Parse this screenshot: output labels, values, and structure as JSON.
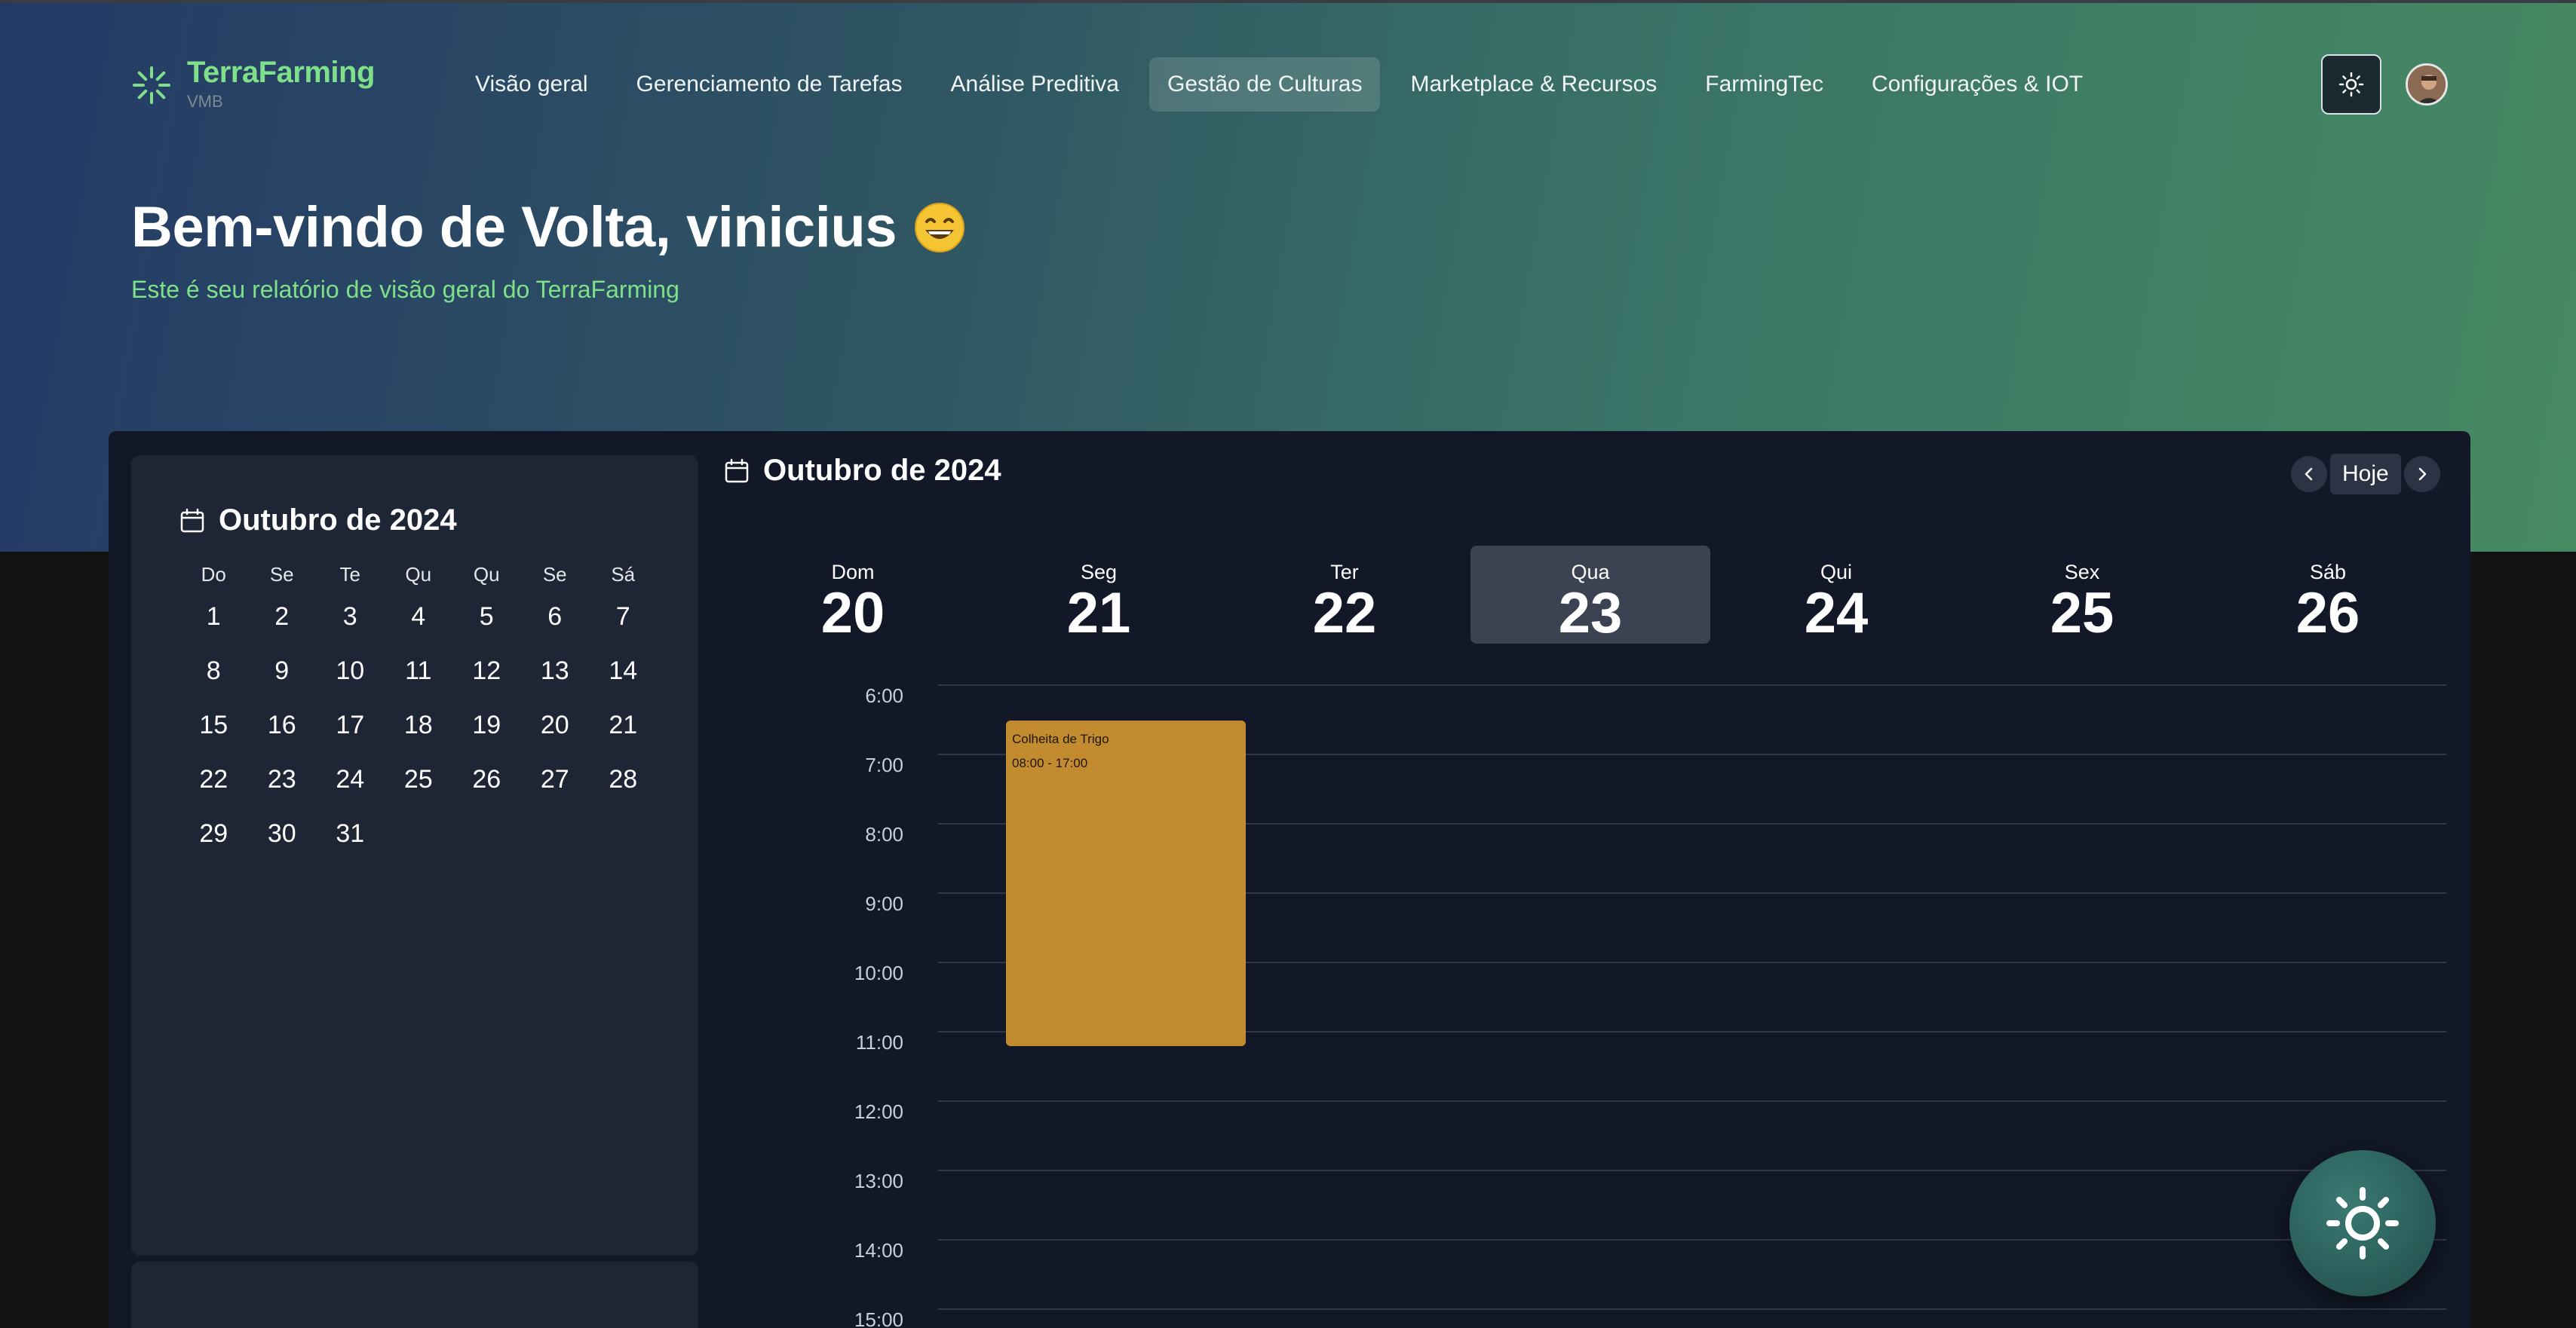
{
  "app": {
    "name": "TerraFarming",
    "subtitle": "VMB"
  },
  "nav": {
    "items": [
      {
        "label": "Visão geral",
        "active": false
      },
      {
        "label": "Gerenciamento de Tarefas",
        "active": false
      },
      {
        "label": "Análise Preditiva",
        "active": false
      },
      {
        "label": "Gestão de Culturas",
        "active": true
      },
      {
        "label": "Marketplace & Recursos",
        "active": false
      },
      {
        "label": "FarmingTec",
        "active": false
      },
      {
        "label": "Configurações & IOT",
        "active": false
      }
    ]
  },
  "header": {
    "theme_toggle_icon": "sun-icon",
    "avatar_icon": "user-avatar"
  },
  "greeting": {
    "title": "Bem-vindo de Volta, vinicius",
    "emoji_icon": "grinning-face-icon",
    "subtitle": "Este é seu relatório de visão geral do TerraFarming"
  },
  "mini_calendar": {
    "month_label": "Outubro de 2024",
    "weekdays": [
      "Do",
      "Se",
      "Te",
      "Qu",
      "Qu",
      "Se",
      "Sá"
    ],
    "days": [
      "1",
      "2",
      "3",
      "4",
      "5",
      "6",
      "7",
      "8",
      "9",
      "10",
      "11",
      "12",
      "13",
      "14",
      "15",
      "16",
      "17",
      "18",
      "19",
      "20",
      "21",
      "22",
      "23",
      "24",
      "25",
      "26",
      "27",
      "28",
      "29",
      "30",
      "31"
    ]
  },
  "week_view": {
    "month_label": "Outubro de 2024",
    "today_label": "Hoje",
    "days": [
      {
        "name": "Dom",
        "number": "20",
        "today": false
      },
      {
        "name": "Seg",
        "number": "21",
        "today": false
      },
      {
        "name": "Ter",
        "number": "22",
        "today": false
      },
      {
        "name": "Qua",
        "number": "23",
        "today": true
      },
      {
        "name": "Qui",
        "number": "24",
        "today": false
      },
      {
        "name": "Sex",
        "number": "25",
        "today": false
      },
      {
        "name": "Sáb",
        "number": "26",
        "today": false
      }
    ],
    "hours": [
      "6:00",
      "7:00",
      "8:00",
      "9:00",
      "10:00",
      "11:00",
      "12:00",
      "13:00",
      "14:00",
      "15:00"
    ],
    "events": [
      {
        "title": "Colheita de Trigo",
        "time": "08:00 - 17:00",
        "day": "Seg",
        "color": "#c38b30"
      }
    ]
  },
  "fab": {
    "icon": "sun-icon"
  },
  "colors": {
    "accent_green": "#7fe08a",
    "panel_bg": "#121827",
    "event": "#c38b30"
  }
}
